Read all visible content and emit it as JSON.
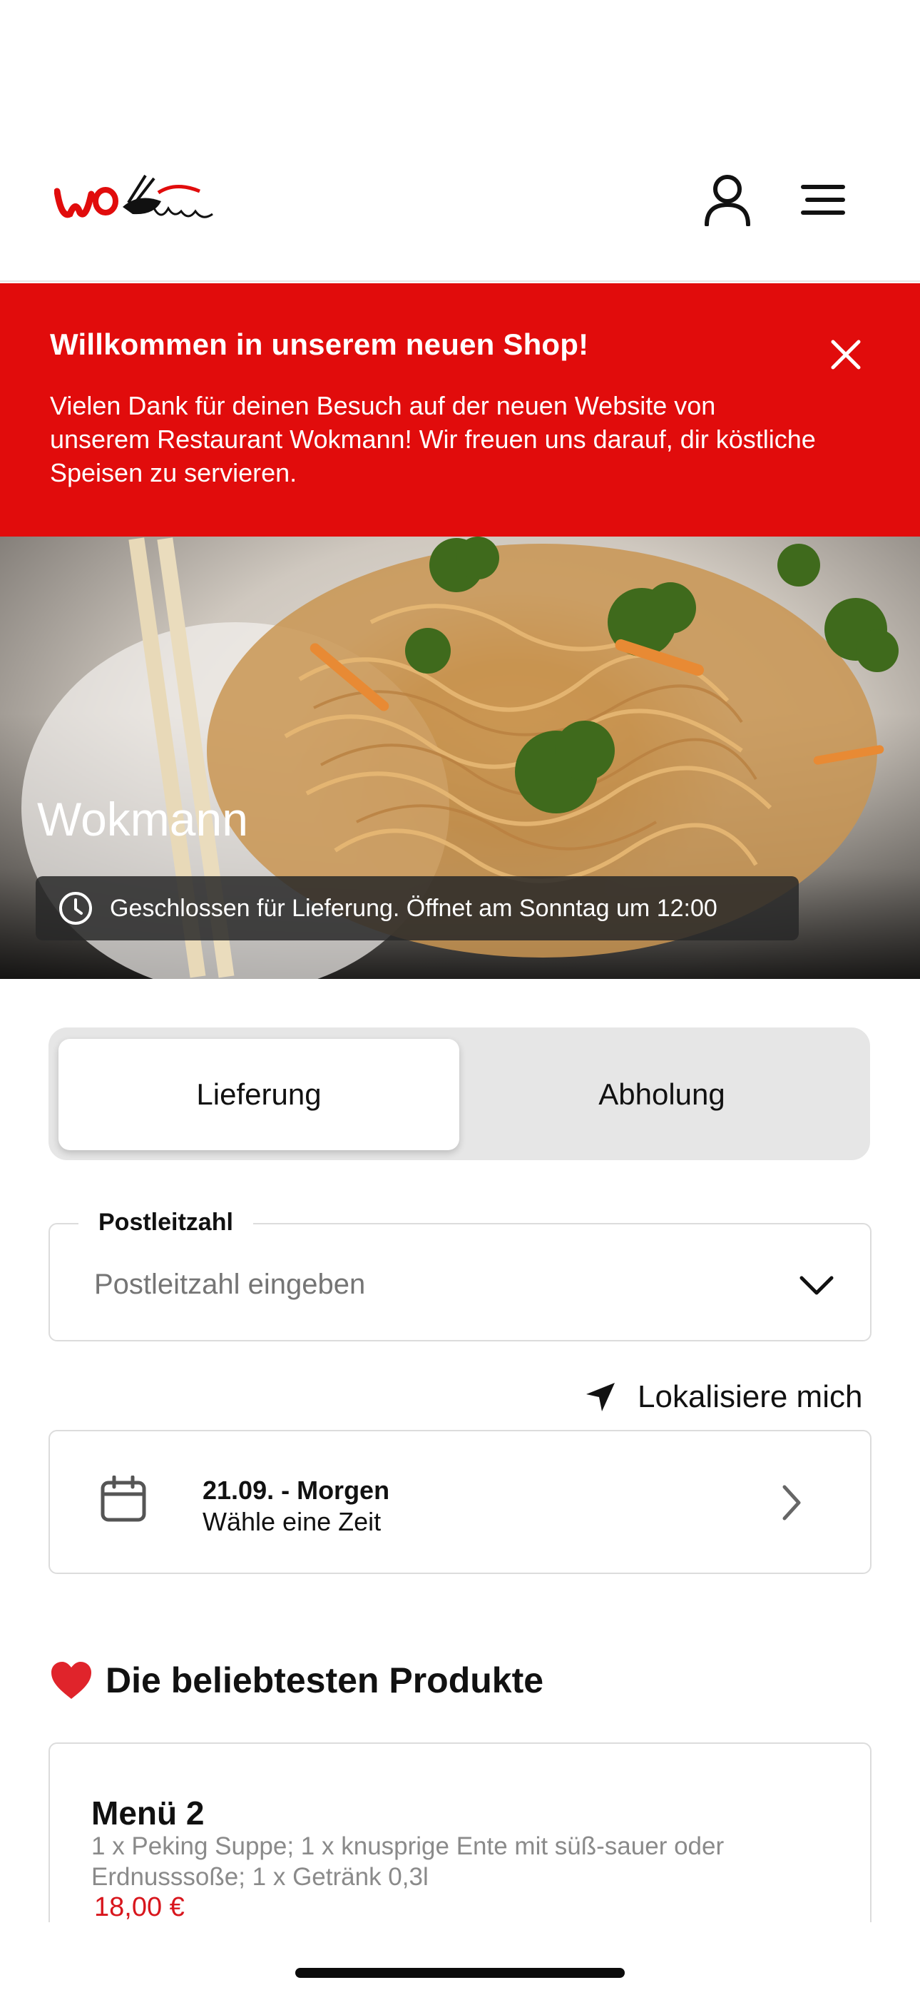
{
  "header": {
    "logo_text": "WokMann",
    "user_icon": "user-icon",
    "menu_icon": "hamburger-menu-icon"
  },
  "banner": {
    "title": "Willkommen in unserem neuen Shop!",
    "text": "Vielen Dank für deinen Besuch auf der neuen Website von unserem Restaurant Wokmann! Wir freuen uns darauf, dir köstliche Speisen zu servieren.",
    "close_icon": "close-icon",
    "background_color": "#e10c0c"
  },
  "hero": {
    "title": "Wokmann",
    "status": "Geschlossen für Lieferung. Öffnet am Sonntag um 12:00",
    "status_icon": "clock-icon"
  },
  "order_mode": {
    "options": [
      "Lieferung",
      "Abholung"
    ],
    "selected": "Lieferung"
  },
  "zip": {
    "label": "Postleitzahl",
    "placeholder": "Postleitzahl eingeben",
    "value": ""
  },
  "locate": {
    "label": "Lokalisiere mich",
    "icon": "location-arrow-icon"
  },
  "time": {
    "date": "21.09. - Morgen",
    "subtitle": "Wähle eine Zeit",
    "icon": "calendar-icon"
  },
  "popular": {
    "title": "Die beliebtesten Produkte",
    "icon": "heart-icon",
    "products": [
      {
        "name": "Menü 2",
        "description": "1 x Peking Suppe; 1 x knusprige Ente mit süß-sauer oder Erdnusssoße; 1 x Getränk 0,3l",
        "price": "18,00 €"
      }
    ]
  },
  "colors": {
    "accent": "#e10c0c",
    "price": "#d8161d"
  }
}
